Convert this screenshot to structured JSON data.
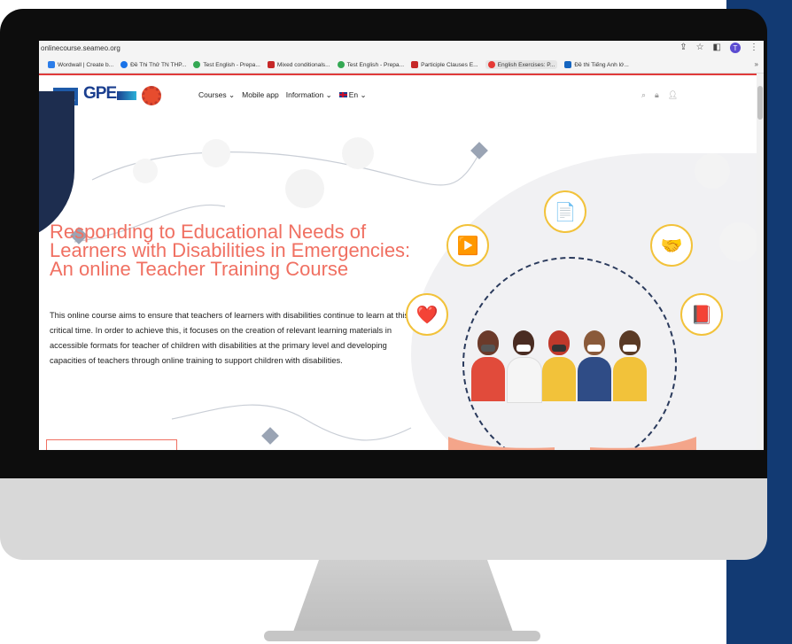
{
  "browser": {
    "url": "onlinecourse.seameo.org",
    "bookmarks": [
      {
        "label": "Wordwall | Create b...",
        "color": "#2b7de9"
      },
      {
        "label": "Đề Thi Thử TN THP...",
        "color": "#1a73e8"
      },
      {
        "label": "Test English - Prepa...",
        "color": "#34a853"
      },
      {
        "label": "Mixed conditionals...",
        "color": "#c62828"
      },
      {
        "label": "Test English - Prepa...",
        "color": "#34a853"
      },
      {
        "label": "Participle Clauses E...",
        "color": "#c62828"
      },
      {
        "label": "English Exercises: P...",
        "color": "#e53935"
      },
      {
        "label": "Đề thi Tiếng Anh lớ...",
        "color": "#1565c0"
      }
    ],
    "more": "»",
    "profile_initial": "T"
  },
  "site": {
    "logo_unesco": "unesco",
    "logo_gpe": "GPE",
    "menu": {
      "courses": "Courses ⌄",
      "mobile_app": "Mobile app",
      "information": "Information ⌄",
      "language": "En ⌄"
    }
  },
  "hero": {
    "title": "Responding to Educational Needs of Learners with Disabilities in Emergencies: An online Teacher Training Course",
    "description": "This online course aims to ensure that teachers of learners with disabilities continue to learn at this critical time. In order to achieve this, it focuses on the creation of relevant learning materials in accessible formats for teacher of children with disabilities at the primary level and developing capacities of teachers through online training to support children with disabilities."
  },
  "colors": {
    "accent": "#f07062",
    "navy": "#123a73",
    "nav_border": "#e03a3a"
  },
  "icons": [
    "share-icon",
    "star-icon",
    "sidebar-icon",
    "menu-icon",
    "search-icon",
    "lock-icon",
    "user-icon"
  ]
}
